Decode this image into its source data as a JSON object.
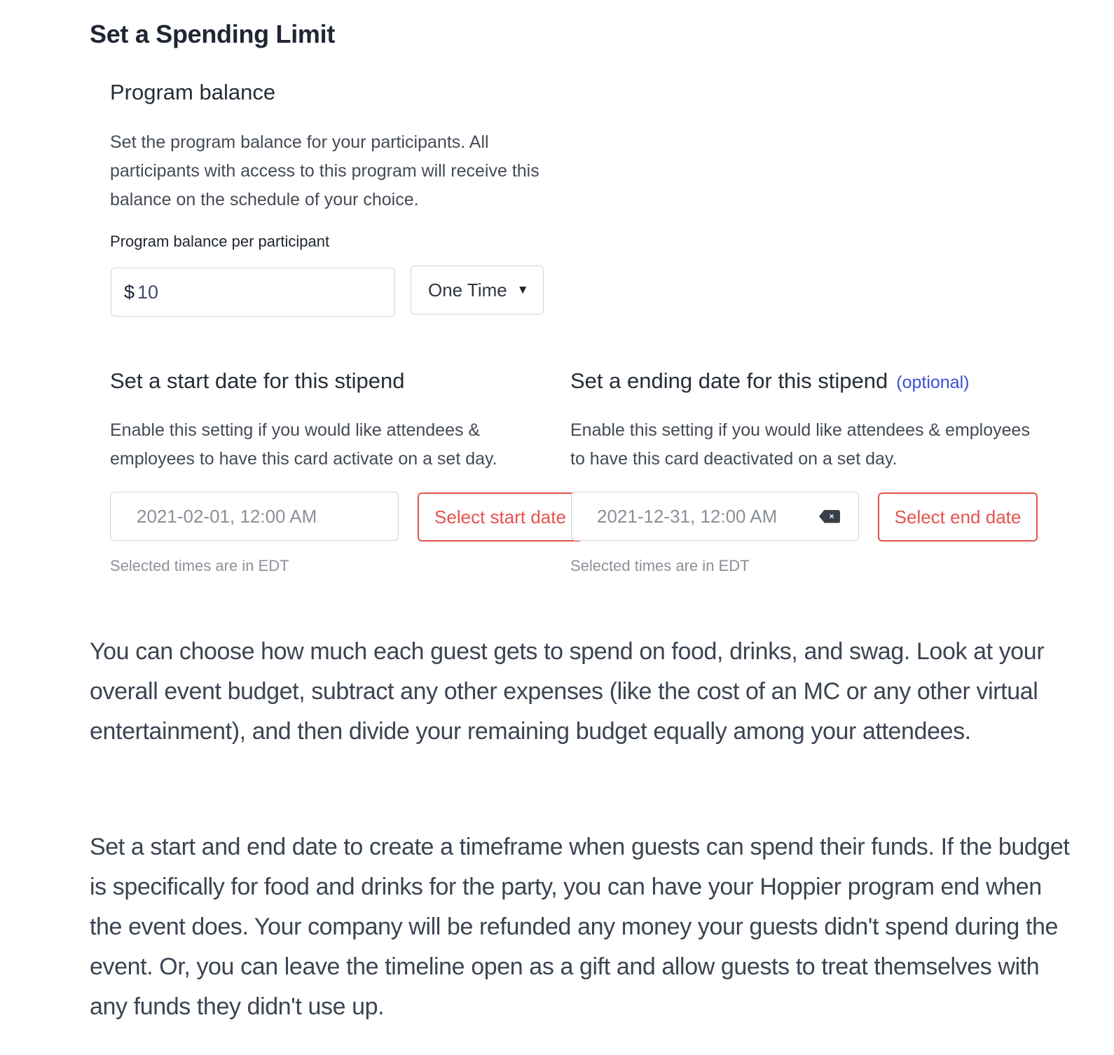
{
  "section_title": "Set a Spending Limit",
  "program_balance": {
    "title": "Program balance",
    "description": "Set the program balance for your participants. All participants with access to this program will receive this balance on the schedule of your choice.",
    "field_label": "Program balance per participant",
    "currency_symbol": "$",
    "amount_value": "10",
    "frequency_selected": "One Time"
  },
  "start_date": {
    "title": "Set a start date for this stipend",
    "description": "Enable this setting if you would like attendees & employees to have this card activate on a set day.",
    "value": "2021-02-01, 12:00 AM",
    "button_label": "Select start date",
    "hint": "Selected times are in EDT"
  },
  "end_date": {
    "title": "Set a ending date for this stipend",
    "optional_label": "(optional)",
    "description": "Enable this setting if you would like attendees & employees to have this card deactivated on a set day.",
    "value": "2021-12-31, 12:00 AM",
    "clear_icon_glyph": "×",
    "button_label": "Select end date",
    "hint": "Selected times are in EDT"
  },
  "article": {
    "paragraph_1": "You can choose how much each guest gets to spend on food, drinks, and swag. Look at your overall event budget, subtract any other expenses (like the cost of an MC or any other virtual entertainment), and then divide your remaining budget equally among your attendees.",
    "paragraph_2": "Set a start and end date to create a timeframe when guests can spend their funds. If the budget is specifically for food and drinks for the party, you can have your Hoppier program end when the event does. Your company will be refunded any money your guests didn't spend during the event. Or, you can leave the timeline open as a gift and allow guests to treat themselves with any funds they didn't use up."
  }
}
